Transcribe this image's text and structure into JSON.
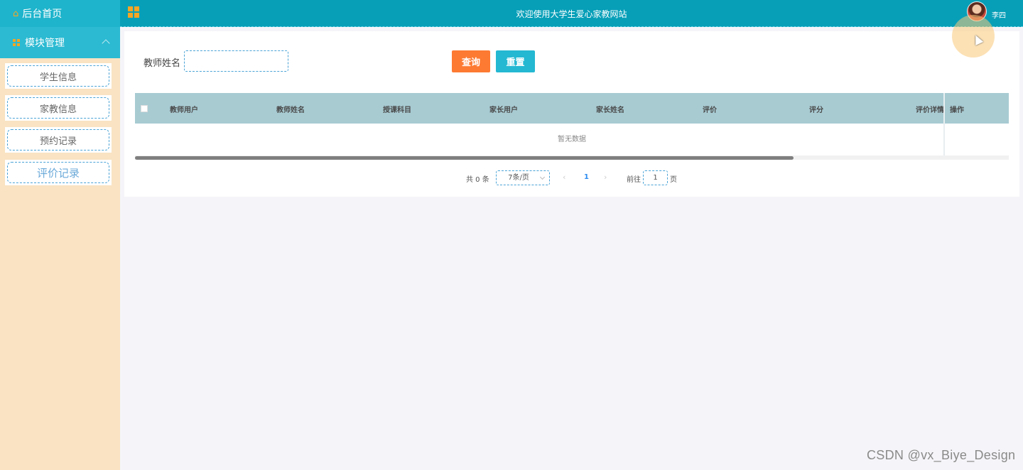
{
  "sidebar": {
    "home_label": "后台首页",
    "module_label": "模块管理",
    "items": [
      {
        "label": "学生信息"
      },
      {
        "label": "家教信息"
      },
      {
        "label": "预约记录"
      },
      {
        "label": "评价记录",
        "active": true
      }
    ]
  },
  "header": {
    "title": "欢迎使用大学生爱心家教网站",
    "username": "李四"
  },
  "search": {
    "label": "教师姓名",
    "value": "",
    "placeholder": "",
    "query_label": "查询",
    "reset_label": "重置"
  },
  "table": {
    "columns": [
      "教师用户",
      "教师姓名",
      "授课科目",
      "家长用户",
      "家长姓名",
      "评价",
      "评分",
      "评价详情",
      "操作"
    ],
    "empty_text": "暂无数据"
  },
  "pagination": {
    "total_text": "共 0 条",
    "page_size": "7条/页",
    "current_page": "1",
    "goto_label": "前往",
    "goto_value": "1",
    "page_unit": "页"
  },
  "watermark": "CSDN @vx_Biye_Design",
  "colors": {
    "header_bg": "#079fb8",
    "sidebar_bg": "#f9e3c2",
    "query_button": "#fd7a32",
    "reset_button": "#24b8d2",
    "table_header": "#a8cbd2"
  }
}
